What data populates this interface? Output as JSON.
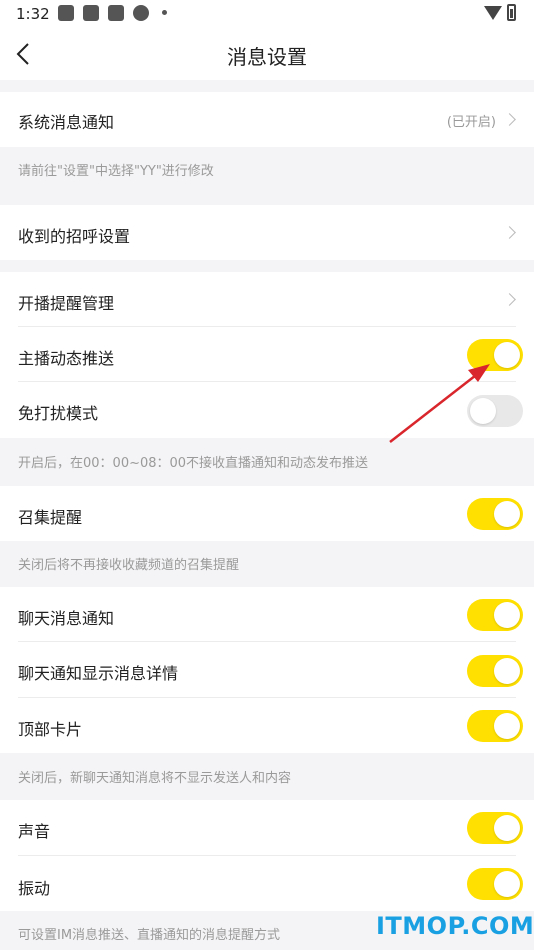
{
  "status_bar": {
    "time": "1:32"
  },
  "header": {
    "title": "消息设置"
  },
  "sections": {
    "system": {
      "label": "系统消息通知",
      "value": "(已开启)",
      "hint": "请前往\"设置\"中选择\"YY\"进行修改"
    },
    "greeting": {
      "label": "收到的招呼设置"
    },
    "live": {
      "reminder_label": "开播提醒管理",
      "anchor_push_label": "主播动态推送",
      "anchor_push_on": true,
      "dnd_label": "免打扰模式",
      "dnd_on": false,
      "hint": "开启后，在00：00~08：00不接收直播通知和动态发布推送"
    },
    "gather": {
      "label": "召集提醒",
      "on": true,
      "hint": "关闭后将不再接收收藏频道的召集提醒"
    },
    "chat": {
      "notify_label": "聊天消息通知",
      "notify_on": true,
      "detail_label": "聊天通知显示消息详情",
      "detail_on": true,
      "card_label": "顶部卡片",
      "card_on": true,
      "hint": "关闭后，新聊天通知消息将不显示发送人和内容"
    },
    "alerts": {
      "sound_label": "声音",
      "sound_on": true,
      "vibrate_label": "振动",
      "vibrate_on": true,
      "hint": "可设置IM消息推送、直播通知的消息提醒方式"
    }
  },
  "watermark": "ITMOP.COM",
  "colors": {
    "toggle_on": "#ffe000",
    "toggle_off": "#e8e8e8",
    "arrow": "#d9262c",
    "watermark": "#19a0e2"
  }
}
